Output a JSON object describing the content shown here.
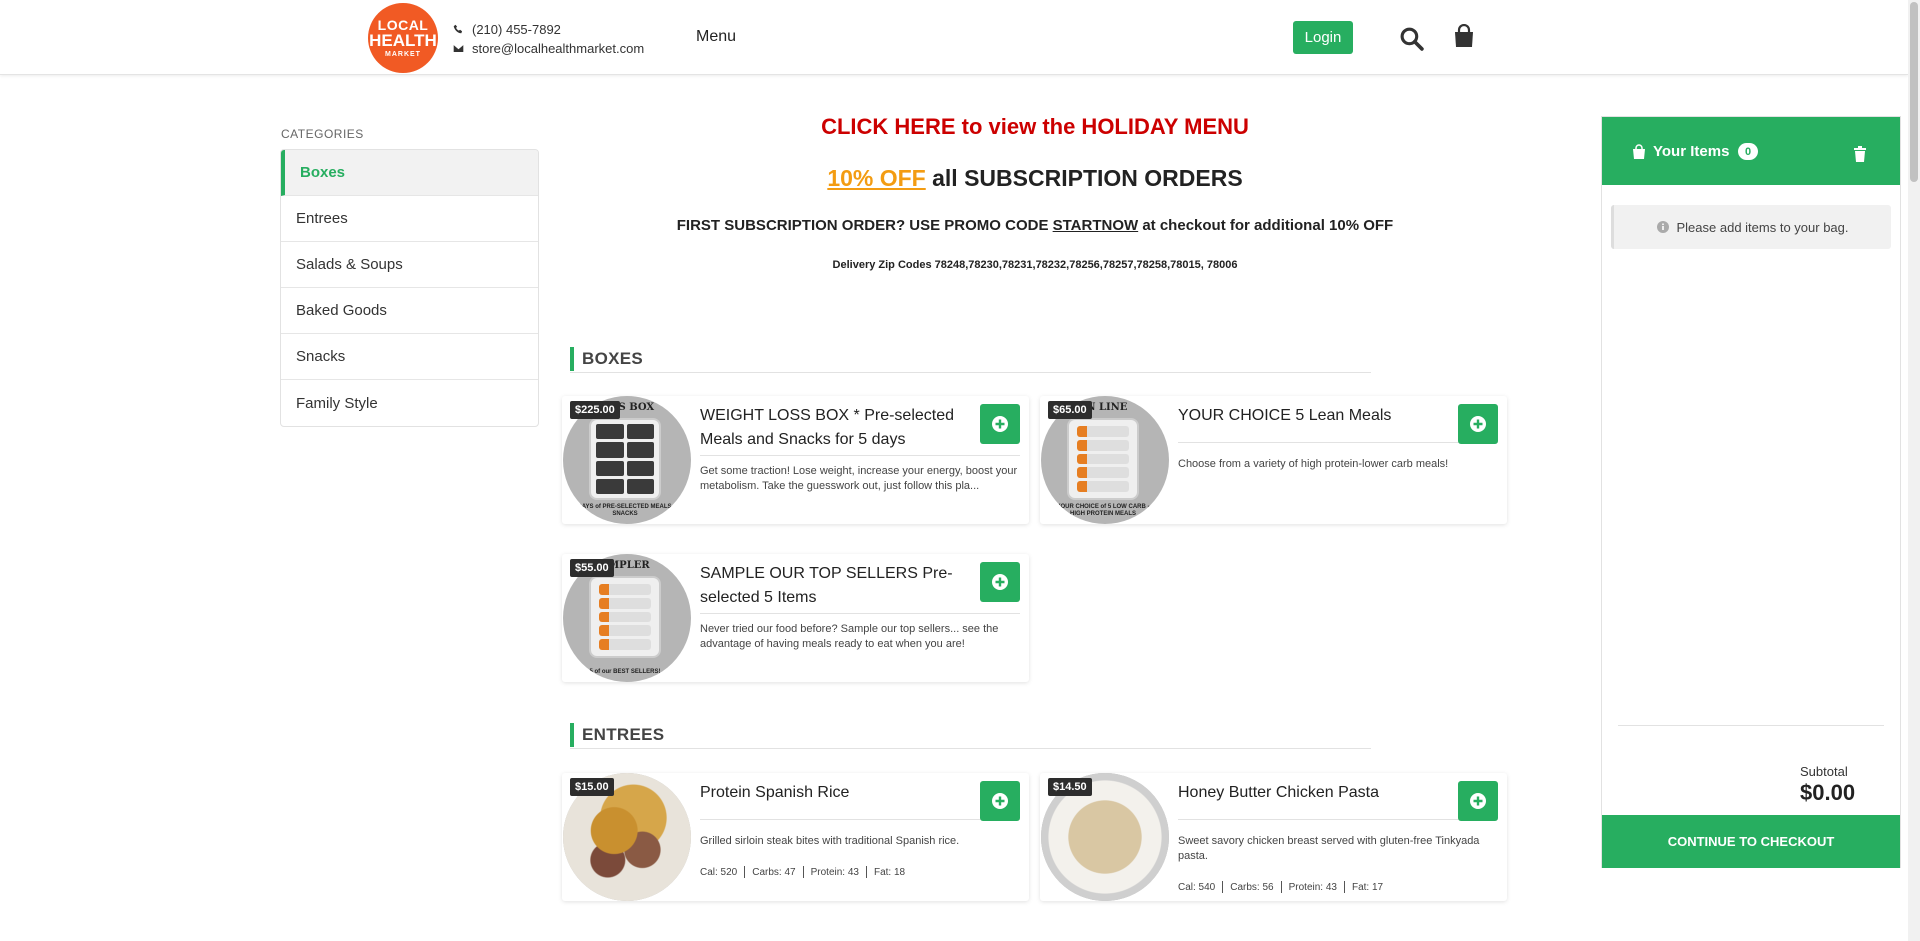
{
  "header": {
    "logo": {
      "line1": "LOCAL",
      "line2": "HEALTH",
      "line3": "MARKET"
    },
    "phone": "(210) 455-7892",
    "email": "store@localhealthmarket.com",
    "menu_label": "Menu",
    "login_label": "Login"
  },
  "sidebar": {
    "title": "CATEGORIES",
    "items": [
      {
        "label": "Boxes",
        "active": true
      },
      {
        "label": "Entrees"
      },
      {
        "label": "Salads & Soups"
      },
      {
        "label": "Baked Goods"
      },
      {
        "label": "Snacks"
      },
      {
        "label": "Family Style"
      }
    ]
  },
  "announcements": {
    "holiday": "CLICK HERE to view the HOLIDAY MENU",
    "subscription_off": "10% OFF",
    "subscription_rest": " all SUBSCRIPTION ORDERS",
    "promo_prefix": "FIRST SUBSCRIPTION ORDER? USE PROMO CODE ",
    "promo_code": "STARTNOW",
    "promo_suffix": " at checkout for additional 10% OFF",
    "zips": "Delivery Zip Codes 78248,78230,78231,78232,78256,78257,78258,78015, 78006"
  },
  "sections": {
    "boxes": {
      "title": "BOXES",
      "products": [
        {
          "price": "$225.00",
          "title": "WEIGHT LOSS BOX * Pre-selected Meals and Snacks for 5 days",
          "desc": "Get some traction! Lose weight, increase your energy, boost your metabolism. Take the guesswork out, just follow this pla...",
          "img_caption": "LOSS BOX",
          "img_foot": "5 DAYS of PRE-SELECTED MEALS & SNACKS"
        },
        {
          "price": "$65.00",
          "title": "YOUR CHOICE 5 Lean Meals",
          "desc": "Choose from a variety of high protein-lower carb meals!",
          "img_caption": "AN LINE",
          "img_foot": "YOUR CHOICE of 5 LOW CARB - HIGH PROTEIN MEALS"
        },
        {
          "price": "$55.00",
          "title": "SAMPLE OUR TOP SELLERS Pre-selected 5 Items",
          "desc": "Never tried our food before? Sample our top sellers... see the advantage of having meals ready to eat when you are!",
          "img_caption": "AMPLER",
          "img_foot": "5 of our BEST SELLERS!"
        }
      ]
    },
    "entrees": {
      "title": "ENTREES",
      "products": [
        {
          "price": "$15.00",
          "title": "Protein Spanish Rice",
          "desc": "Grilled sirloin steak bites with traditional Spanish rice.",
          "cal": "Cal: 520",
          "carbs": "Carbs: 47",
          "protein": "Protein: 43",
          "fat": "Fat: 18"
        },
        {
          "price": "$14.50",
          "title": "Honey Butter Chicken Pasta",
          "desc": "Sweet savory chicken breast served with gluten-free Tinkyada pasta.",
          "cal": "Cal: 540",
          "carbs": "Carbs: 56",
          "protein": "Protein: 43",
          "fat": "Fat: 17"
        }
      ]
    }
  },
  "cart": {
    "title": "Your Items",
    "count": "0",
    "empty_message": "Please add items to your bag.",
    "subtotal_label": "Subtotal",
    "subtotal_value": "$0.00",
    "checkout_label": "CONTINUE TO CHECKOUT"
  },
  "colors": {
    "brand_green": "#27ae60",
    "logo_orange": "#f15a24",
    "holiday_red": "#cc0000",
    "offer_orange": "#f39c12"
  },
  "icons": [
    "phone-icon",
    "mail-icon",
    "search-icon",
    "shopping-bag-icon",
    "plus-circle-icon",
    "trash-icon",
    "info-icon"
  ]
}
